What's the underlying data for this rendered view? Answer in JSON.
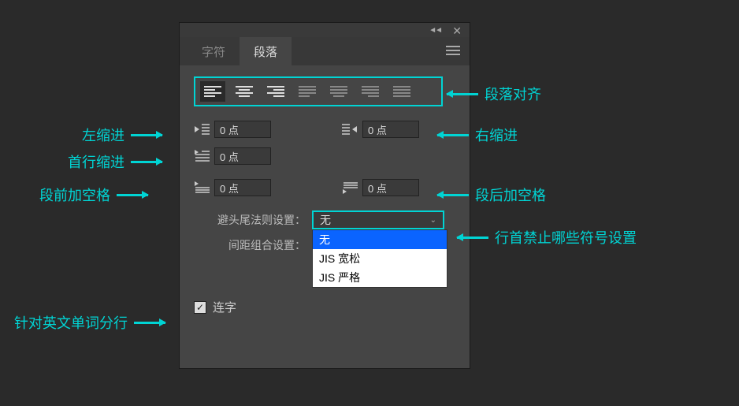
{
  "tabs": {
    "char": "字符",
    "para": "段落"
  },
  "fields": {
    "left_indent": "0 点",
    "right_indent": "0 点",
    "first_line": "0 点",
    "space_before": "0 点",
    "space_after": "0 点"
  },
  "settings": {
    "kinsoku_label": "避头尾法则设置：",
    "kinsoku_value": "无",
    "spacing_label": "间距组合设置：",
    "options": [
      "无",
      "JIS 宽松",
      "JIS 严格"
    ]
  },
  "checkbox": {
    "label": "连字",
    "checked": true
  },
  "annotations": {
    "alignment": "段落对齐",
    "left_indent": "左缩进",
    "right_indent": "右缩进",
    "first_line": "首行缩进",
    "space_before": "段前加空格",
    "space_after": "段后加空格",
    "kinsoku": "行首禁止哪些符号设置",
    "hyphenate": "针对英文单词分行"
  }
}
